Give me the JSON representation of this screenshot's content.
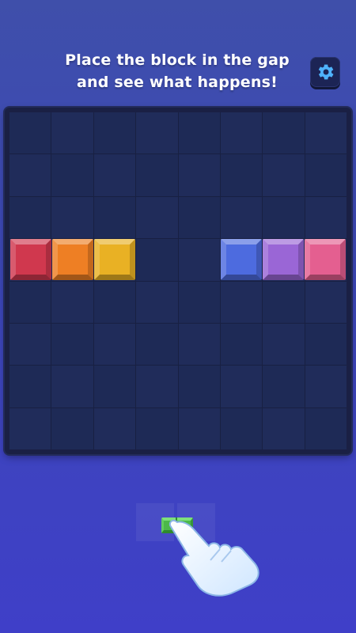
{
  "header": {
    "instruction_line1": "Place the block in the gap",
    "instruction_line2": "and see what happens!",
    "settings_icon": "gear-icon"
  },
  "board": {
    "rows": 8,
    "cols": 8,
    "filled_row": 3,
    "tiles": [
      {
        "col": 0,
        "color": "#d0384e",
        "name": "red"
      },
      {
        "col": 1,
        "color": "#ee7f24",
        "name": "orange"
      },
      {
        "col": 2,
        "color": "#e9b124",
        "name": "yellow"
      },
      {
        "col": 5,
        "color": "#4d6bdf",
        "name": "blue"
      },
      {
        "col": 6,
        "color": "#9a66d6",
        "name": "purple"
      },
      {
        "col": 7,
        "color": "#e45f90",
        "name": "pink"
      }
    ],
    "gap_cols": [
      3,
      4
    ]
  },
  "tray": {
    "piece_color": "#4cb84a",
    "piece_size": "1x2",
    "hint_icon": "pointing-hand-icon"
  },
  "colors": {
    "background": "#3c47b8",
    "board": "#1a2044",
    "cell": "#1e2a56"
  }
}
